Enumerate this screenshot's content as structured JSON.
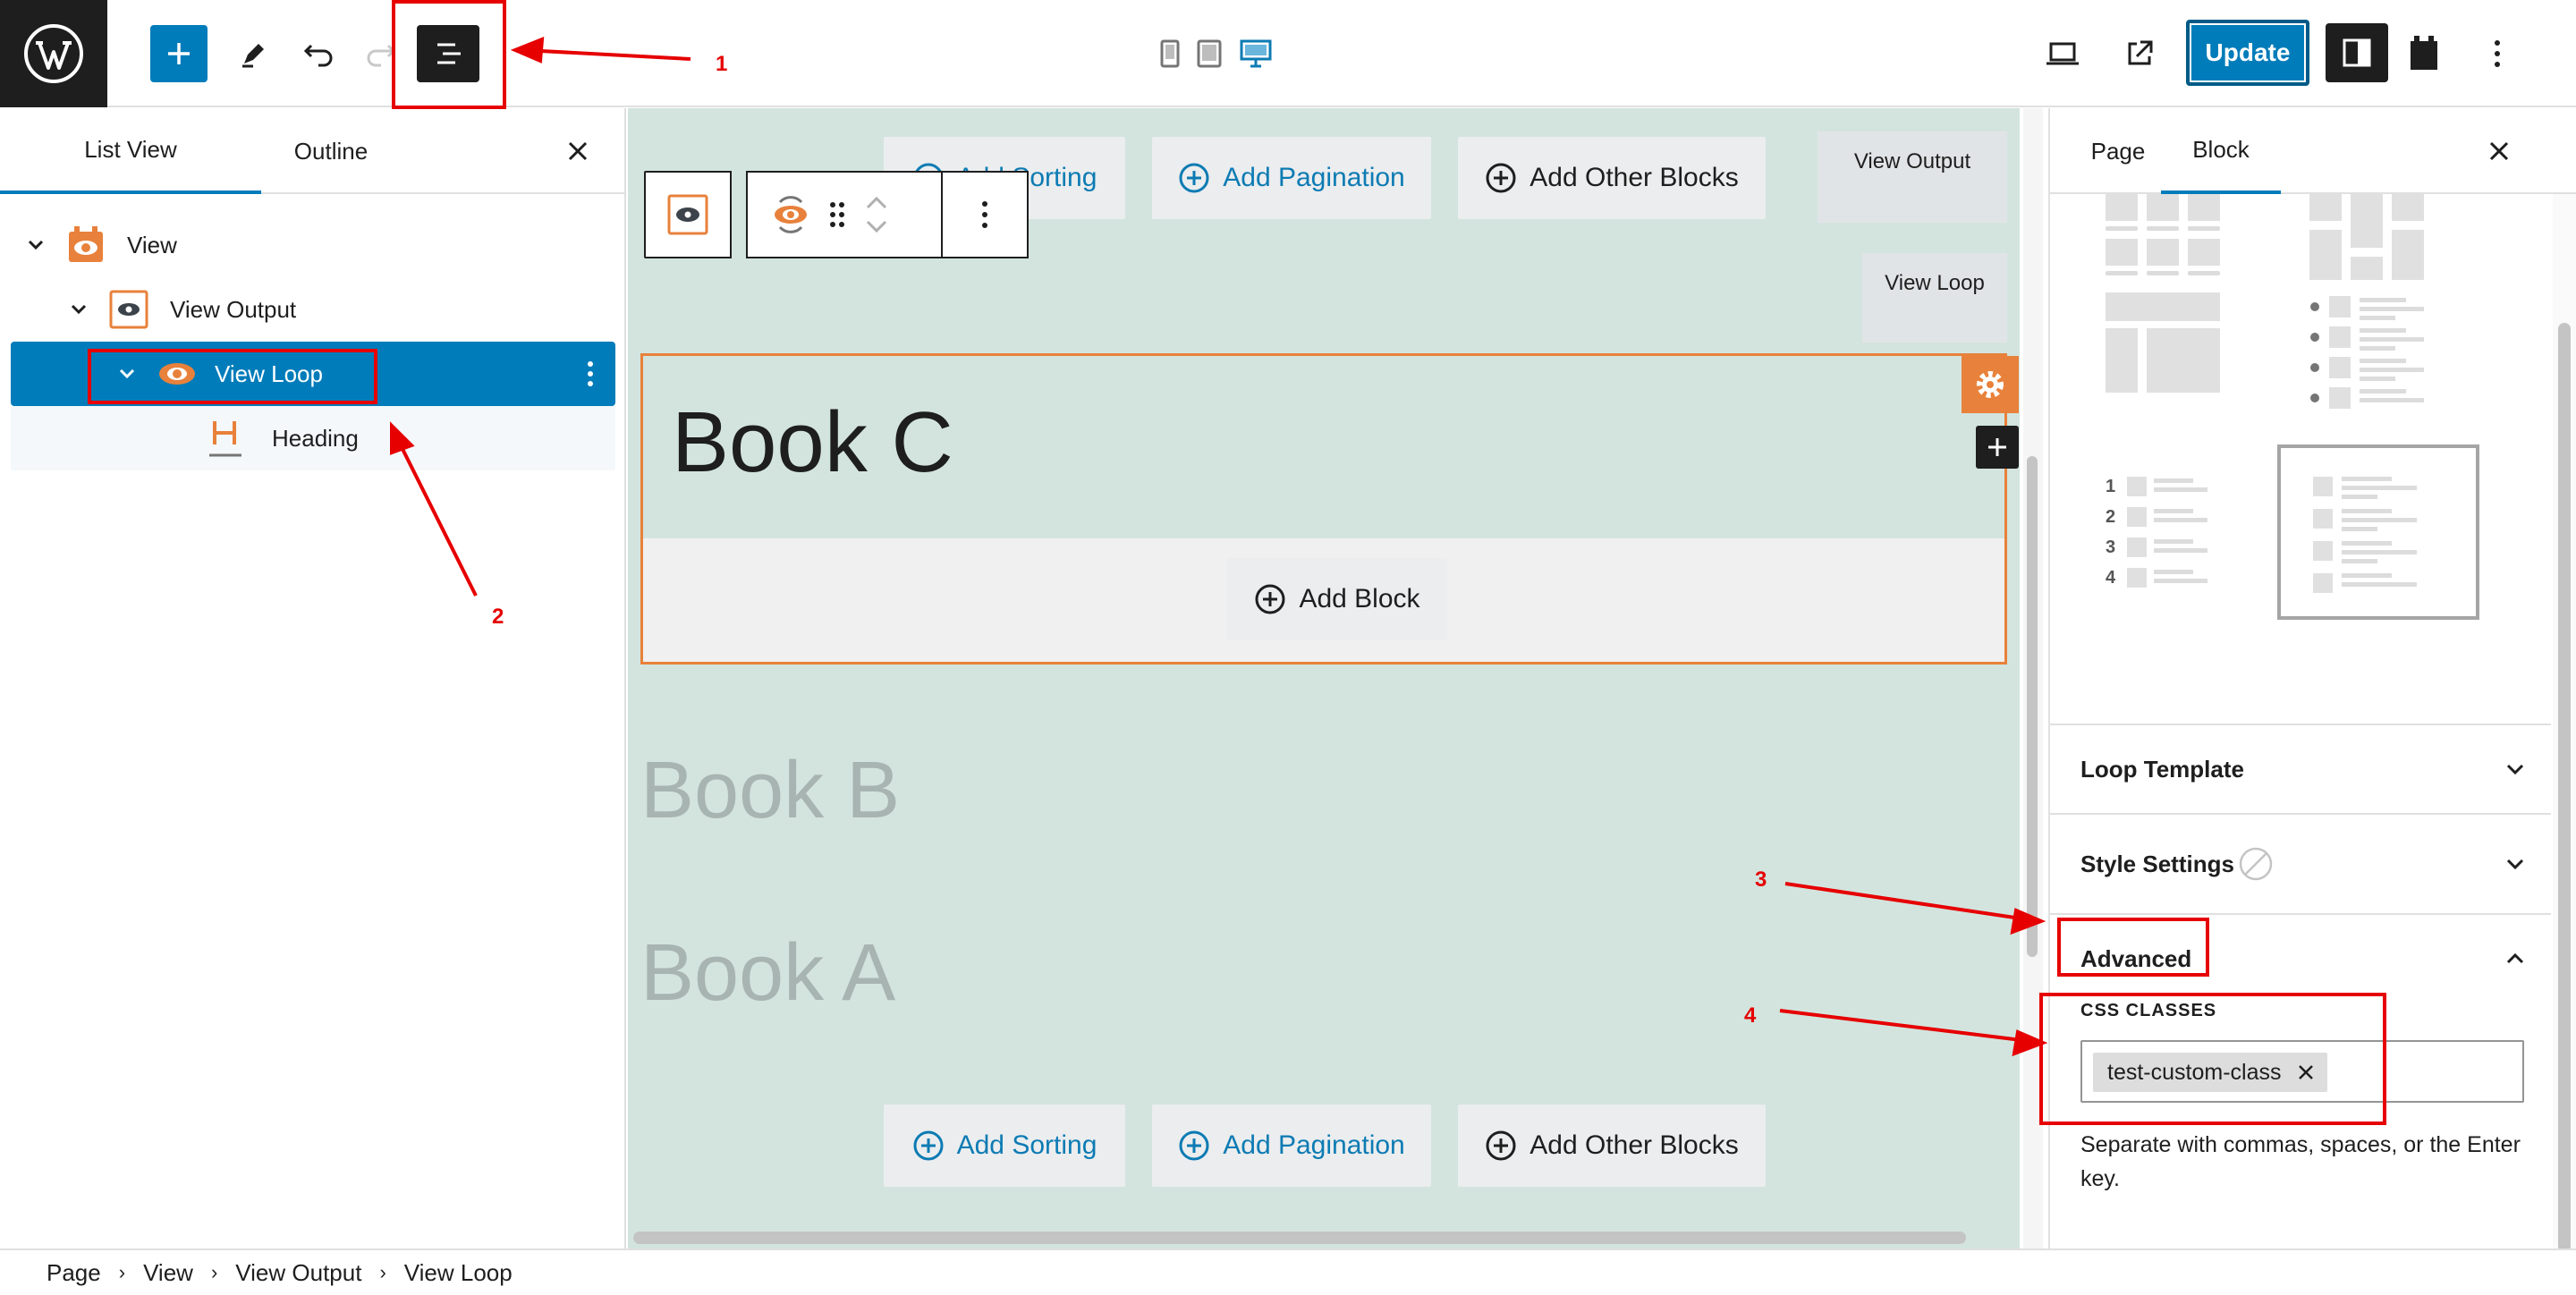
{
  "topbar": {
    "update_label": "Update"
  },
  "list_panel": {
    "tabs": [
      {
        "label": "List View"
      },
      {
        "label": "Outline"
      }
    ],
    "tree": [
      {
        "label": "View"
      },
      {
        "label": "View Output"
      },
      {
        "label": "View Loop"
      },
      {
        "label": "Heading"
      }
    ]
  },
  "canvas": {
    "top_buttons": {
      "sorting": "Add Sorting",
      "pagination": "Add Pagination",
      "other": "Add Other Blocks"
    },
    "tags": {
      "view_output": "View Output",
      "view_loop": "View Loop"
    },
    "heading_text": "Book C",
    "add_block_label": "Add Block",
    "faded_items": [
      "Book B",
      "Book A"
    ],
    "bottom_buttons": {
      "sorting": "Add Sorting",
      "pagination": "Add Pagination",
      "other": "Add Other Blocks"
    }
  },
  "settings_panel": {
    "tabs": [
      {
        "label": "Page"
      },
      {
        "label": "Block"
      }
    ],
    "list_numbers": [
      "1",
      "2",
      "3",
      "4"
    ],
    "sections": {
      "loop_template": "Loop Template",
      "style_settings": "Style Settings",
      "advanced": "Advanced"
    },
    "css_classes_label": "CSS CLASSES",
    "css_token": "test-custom-class",
    "help_text": "Separate with commas, spaces, or the Enter key."
  },
  "breadcrumb": {
    "items": [
      "Page",
      "View",
      "View Output",
      "View Loop"
    ]
  },
  "annotations": [
    "1",
    "2",
    "3",
    "4"
  ],
  "colors": {
    "accent": "#007cba",
    "brand_orange": "#e8813b",
    "canvas_bg": "#d3e4de",
    "annotation_red": "#e60000"
  }
}
